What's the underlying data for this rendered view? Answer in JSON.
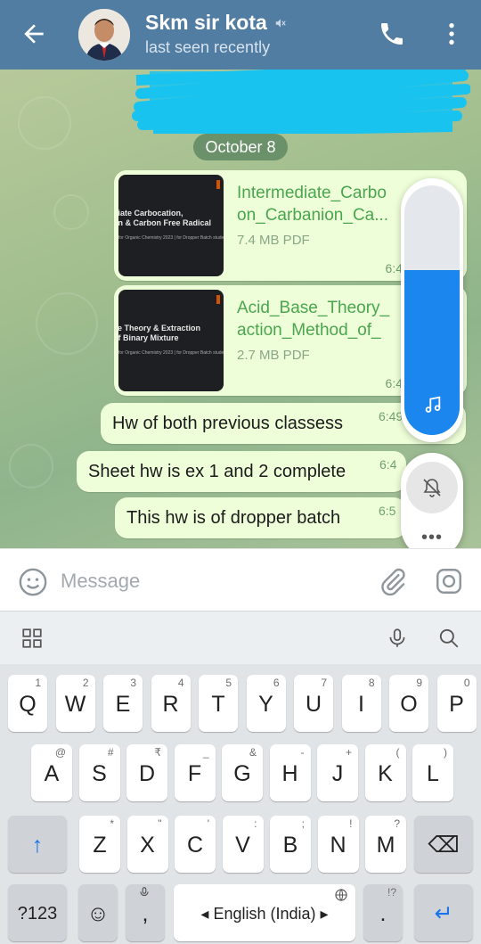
{
  "header": {
    "contact_name": "Skm sir kota",
    "status": "last seen recently",
    "back_icon": "arrow-left-icon",
    "muted_icon": "speaker-muted-icon",
    "call_icon": "phone-icon",
    "menu_icon": "vertical-dots-icon"
  },
  "chat": {
    "date_label": "October 8",
    "files": [
      {
        "name_line1": "Intermediate_Carbo",
        "name_line2": "on_Carbanion_Ca...",
        "size": "7.4 MB PDF",
        "time": "6:4",
        "thumb_line1": "diate Carbocation,",
        "thumb_line2": "on & Carbon Free Radical",
        "thumb_caption": "for Organic Chemistry 2023 | for Dropper Batch students"
      },
      {
        "name_line1": "Acid_Base_Theory_",
        "name_line2": "action_Method_of_",
        "size": "2.7 MB PDF",
        "time": "6:4",
        "thumb_line1": "se Theory & Extraction",
        "thumb_line2": "of Binary Mixture",
        "thumb_caption": "for Organic Chemistry 2023 | for Dropper Batch students"
      }
    ],
    "messages": [
      {
        "text": "Hw of both previous classess",
        "time": "6:49"
      },
      {
        "text": "Sheet hw is ex 1 and 2 complete",
        "time": "6:4"
      },
      {
        "text": "This hw is of dropper  batch",
        "time": "6:5"
      }
    ]
  },
  "volume_panel": {
    "level_fraction": 0.66,
    "media_icon": "music-note-icon",
    "ringer_icon": "bell-off-icon",
    "more_label": "•••",
    "accent_color": "#1a86ee"
  },
  "composer": {
    "placeholder": "Message",
    "value": "",
    "emoji_icon": "emoji-icon",
    "attach_icon": "paperclip-icon",
    "camera_icon": "instagram-camera-icon"
  },
  "keyboard": {
    "toolbar_icons": [
      "apps-grid-icon",
      "mic-icon",
      "search-icon"
    ],
    "row1": [
      {
        "k": "Q",
        "h": "1"
      },
      {
        "k": "W",
        "h": "2"
      },
      {
        "k": "E",
        "h": "3"
      },
      {
        "k": "R",
        "h": "4"
      },
      {
        "k": "T",
        "h": "5"
      },
      {
        "k": "Y",
        "h": "6"
      },
      {
        "k": "U",
        "h": "7"
      },
      {
        "k": "I",
        "h": "8"
      },
      {
        "k": "O",
        "h": "9"
      },
      {
        "k": "P",
        "h": "0"
      }
    ],
    "row2": [
      {
        "k": "A",
        "h": "@"
      },
      {
        "k": "S",
        "h": "#"
      },
      {
        "k": "D",
        "h": "₹"
      },
      {
        "k": "F",
        "h": "_"
      },
      {
        "k": "G",
        "h": "&"
      },
      {
        "k": "H",
        "h": "-"
      },
      {
        "k": "J",
        "h": "+"
      },
      {
        "k": "K",
        "h": "("
      },
      {
        "k": "L",
        "h": ")"
      }
    ],
    "row3": [
      {
        "k": "Z",
        "h": "*"
      },
      {
        "k": "X",
        "h": "\""
      },
      {
        "k": "C",
        "h": "'"
      },
      {
        "k": "V",
        "h": ":"
      },
      {
        "k": "B",
        "h": ";"
      },
      {
        "k": "N",
        "h": "!"
      },
      {
        "k": "M",
        "h": "?"
      }
    ],
    "shift_label": "↑",
    "backspace_label": "⌫",
    "symbols_label": "?123",
    "emoji_key_label": "☺",
    "comma_label": ",",
    "space_label": "◂ English (India) ▸",
    "period_label": ".",
    "period_hint": "!?",
    "enter_label": "↵"
  }
}
